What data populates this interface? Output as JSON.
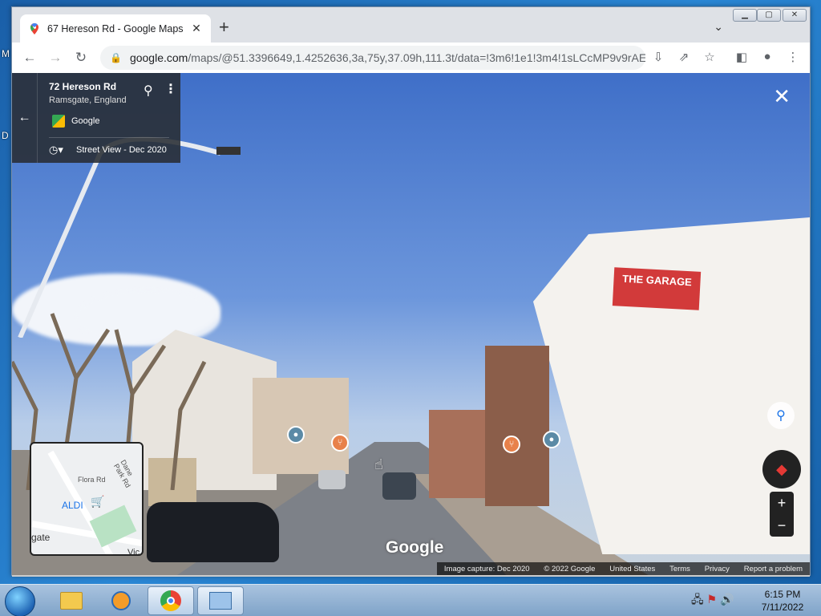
{
  "browser": {
    "tab_title": "67 Hereson Rd - Google Maps",
    "url_host": "google.com",
    "url_rest": "/maps/@51.3396649,1.4252636,3a,75y,37.09h,111.3t/data=!3m6!1e1!3m4!1sLCcMP9v9rAE..."
  },
  "streetview": {
    "address": "72 Hereson Rd",
    "locality": "Ramsgate, England",
    "source": "Google",
    "history_label": "Street View - Dec 2020",
    "sign_text": "THE GARAGE"
  },
  "minimap": {
    "labels": {
      "street1": "Dane Park Rd",
      "street2": "Flora Rd",
      "store": "ALDI",
      "partial1": "gate",
      "partial2": "Vic"
    }
  },
  "footer": {
    "capture": "Image capture: Dec 2020",
    "copyright": "© 2022 Google",
    "region": "United States",
    "terms": "Terms",
    "privacy": "Privacy",
    "report": "Report a problem"
  },
  "logo": "Google",
  "taskbar": {
    "time": "6:15 PM",
    "date": "7/11/2022"
  },
  "desktop_letters": [
    "M",
    "D"
  ]
}
